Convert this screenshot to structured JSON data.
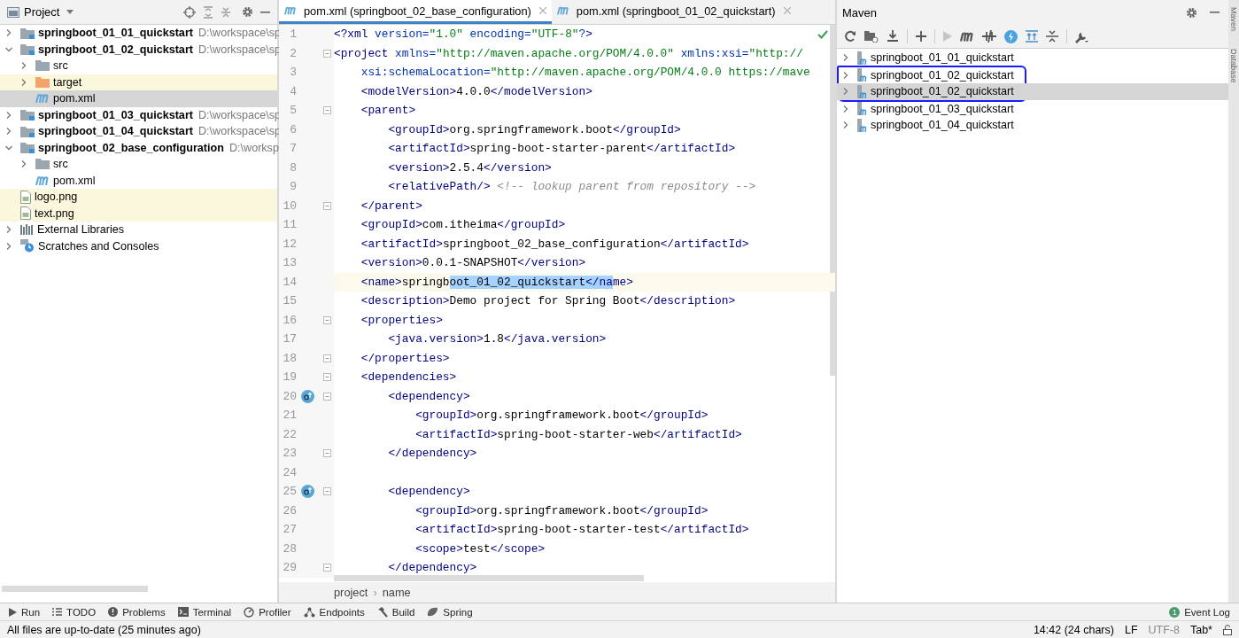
{
  "project_panel": {
    "title": "Project",
    "tree": [
      {
        "name": "springboot_01_01_quickstart",
        "path": "D:\\workspace\\sp",
        "kind": "module",
        "expanded": false,
        "selected": false,
        "highlighted": false
      },
      {
        "name": "springboot_01_02_quickstart",
        "path": "D:\\workspace\\sp",
        "kind": "module",
        "expanded": true,
        "selected": false,
        "highlighted": false,
        "children": [
          {
            "name": "src",
            "kind": "folder",
            "expanded": false,
            "selected": false,
            "highlighted": false
          },
          {
            "name": "target",
            "kind": "excluded-folder",
            "expanded": false,
            "selected": false,
            "highlighted": true
          },
          {
            "name": "pom.xml",
            "kind": "maven-file",
            "selected": true,
            "highlighted": false
          }
        ]
      },
      {
        "name": "springboot_01_03_quickstart",
        "path": "D:\\workspace\\sp",
        "kind": "module",
        "expanded": false,
        "selected": false,
        "highlighted": false
      },
      {
        "name": "springboot_01_04_quickstart",
        "path": "D:\\workspace\\sp",
        "kind": "module",
        "expanded": false,
        "selected": false,
        "highlighted": false
      },
      {
        "name": "springboot_02_base_configuration",
        "path": "D:\\worksp",
        "kind": "module",
        "expanded": true,
        "selected": false,
        "highlighted": false,
        "children": [
          {
            "name": "src",
            "kind": "folder",
            "expanded": false,
            "selected": false,
            "highlighted": false
          },
          {
            "name": "pom.xml",
            "kind": "maven-file",
            "selected": false,
            "highlighted": false
          }
        ]
      },
      {
        "name": "logo.png",
        "kind": "image",
        "selected": false,
        "highlighted": true
      },
      {
        "name": "text.png",
        "kind": "image",
        "selected": false,
        "highlighted": true
      },
      {
        "name": "External Libraries",
        "kind": "libraries",
        "expanded": false,
        "selected": false,
        "highlighted": false
      },
      {
        "name": "Scratches and Consoles",
        "kind": "scratches",
        "expanded": false,
        "selected": false,
        "highlighted": false
      }
    ]
  },
  "editor": {
    "tabs": [
      {
        "label": "pom.xml (springboot_02_base_configuration)",
        "selected": true
      },
      {
        "label": "pom.xml (springboot_01_02_quickstart)",
        "selected": false
      }
    ],
    "lines": [
      {
        "number": "1",
        "text": "<?xml version=\"1.0\" encoding=\"UTF-8\"?>",
        "fold": false,
        "gutter_icon": false,
        "current": false
      },
      {
        "number": "2",
        "text": "<project xmlns=\"http://maven.apache.org/POM/4.0.0\" xmlns:xsi=\"http://",
        "fold": true,
        "gutter_icon": false,
        "current": false
      },
      {
        "number": "3",
        "text": "    xsi:schemaLocation=\"http://maven.apache.org/POM/4.0.0 https://mave",
        "fold": false,
        "gutter_icon": false,
        "current": false
      },
      {
        "number": "4",
        "text": "    <modelVersion>4.0.0</modelVersion>",
        "fold": false,
        "gutter_icon": false,
        "current": false
      },
      {
        "number": "5",
        "text": "    <parent>",
        "fold": true,
        "gutter_icon": false,
        "current": false
      },
      {
        "number": "6",
        "text": "        <groupId>org.springframework.boot</groupId>",
        "fold": false,
        "gutter_icon": false,
        "current": false
      },
      {
        "number": "7",
        "text": "        <artifactId>spring-boot-starter-parent</artifactId>",
        "fold": false,
        "gutter_icon": false,
        "current": false
      },
      {
        "number": "8",
        "text": "        <version>2.5.4</version>",
        "fold": false,
        "gutter_icon": false,
        "current": false
      },
      {
        "number": "9",
        "text": "        <relativePath/> <!-- lookup parent from repository -->",
        "fold": false,
        "gutter_icon": false,
        "current": false
      },
      {
        "number": "10",
        "text": "    </parent>",
        "fold": true,
        "gutter_icon": false,
        "current": false
      },
      {
        "number": "11",
        "text": "    <groupId>com.itheima</groupId>",
        "fold": false,
        "gutter_icon": false,
        "current": false
      },
      {
        "number": "12",
        "text": "    <artifactId>springboot_02_base_configuration</artifactId>",
        "fold": false,
        "gutter_icon": false,
        "current": false
      },
      {
        "number": "13",
        "text": "    <version>0.0.1-SNAPSHOT</version>",
        "fold": false,
        "gutter_icon": false,
        "current": false
      },
      {
        "number": "14",
        "parts": [
          {
            "text": "    <name>springb",
            "selected": false
          },
          {
            "text": "oot_01_02_quickstart</na",
            "selected": true
          },
          {
            "text": "me>",
            "selected": false
          }
        ],
        "fold": false,
        "gutter_icon": false,
        "current": true
      },
      {
        "number": "15",
        "text": "    <description>Demo project for Spring Boot</description>",
        "fold": false,
        "gutter_icon": false,
        "current": false
      },
      {
        "number": "16",
        "text": "    <properties>",
        "fold": true,
        "gutter_icon": false,
        "current": false
      },
      {
        "number": "17",
        "text": "        <java.version>1.8</java.version>",
        "fold": false,
        "gutter_icon": false,
        "current": false
      },
      {
        "number": "18",
        "text": "    </properties>",
        "fold": true,
        "gutter_icon": false,
        "current": false
      },
      {
        "number": "19",
        "text": "    <dependencies>",
        "fold": true,
        "gutter_icon": false,
        "current": false
      },
      {
        "number": "20",
        "text": "        <dependency>",
        "fold": true,
        "gutter_icon": true,
        "current": false
      },
      {
        "number": "21",
        "text": "            <groupId>org.springframework.boot</groupId>",
        "fold": false,
        "gutter_icon": false,
        "current": false
      },
      {
        "number": "22",
        "text": "            <artifactId>spring-boot-starter-web</artifactId>",
        "fold": false,
        "gutter_icon": false,
        "current": false
      },
      {
        "number": "23",
        "text": "        </dependency>",
        "fold": true,
        "gutter_icon": false,
        "current": false
      },
      {
        "number": "24",
        "fold": false,
        "gutter_icon": false,
        "current": false
      },
      {
        "number": "25",
        "text": "        <dependency>",
        "fold": true,
        "gutter_icon": true,
        "current": false
      },
      {
        "number": "26",
        "text": "            <groupId>org.springframework.boot</groupId>",
        "fold": false,
        "gutter_icon": false,
        "current": false
      },
      {
        "number": "27",
        "text": "            <artifactId>spring-boot-starter-test</artifactId>",
        "fold": false,
        "gutter_icon": false,
        "current": false
      },
      {
        "number": "28",
        "text": "            <scope>test</scope>",
        "fold": false,
        "gutter_icon": false,
        "current": false
      },
      {
        "number": "29",
        "text": "        </dependency>",
        "fold": true,
        "gutter_icon": false,
        "current": false
      }
    ],
    "breadcrumbs": [
      "project",
      "name"
    ],
    "breadcrumb_separator": "›"
  },
  "maven_panel": {
    "title": "Maven",
    "projects": [
      {
        "name": "springboot_01_01_quickstart",
        "selected": false
      },
      {
        "name": "springboot_01_02_quickstart",
        "selected": false,
        "annotated": true
      },
      {
        "name": "springboot_01_02_quickstart",
        "selected": true,
        "annotated": true
      },
      {
        "name": "springboot_01_03_quickstart",
        "selected": false
      },
      {
        "name": "springboot_01_04_quickstart",
        "selected": false
      }
    ]
  },
  "side_tabs": [
    "Maven",
    "Database"
  ],
  "tool_windows": [
    {
      "label": "Run",
      "kind": "run"
    },
    {
      "label": "TODO",
      "kind": "todo"
    },
    {
      "label": "Problems",
      "kind": "problems"
    },
    {
      "label": "Terminal",
      "kind": "terminal"
    },
    {
      "label": "Profiler",
      "kind": "profiler"
    },
    {
      "label": "Endpoints",
      "kind": "endpoints"
    },
    {
      "label": "Build",
      "kind": "build"
    },
    {
      "label": "Spring",
      "kind": "spring"
    }
  ],
  "event_log": {
    "label": "Event Log",
    "count": "1"
  },
  "status_bar": {
    "message": "All files are up-to-date (25 minutes ago)",
    "position": "14:42 (24 chars)",
    "line_separator": "LF",
    "encoding": "UTF-8",
    "indent": "Tab*"
  }
}
